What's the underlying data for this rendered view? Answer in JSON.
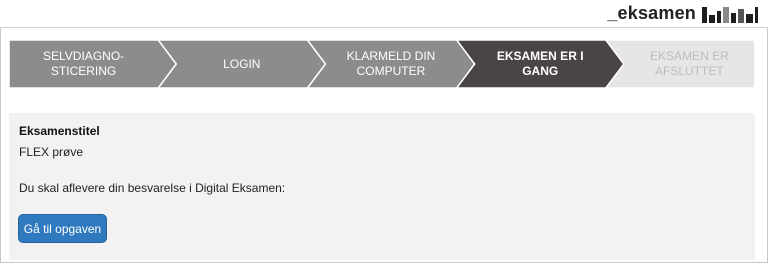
{
  "header": {
    "brand": "_eksamen"
  },
  "steps": [
    {
      "label": "SELVDIAGNO-\nSTICERING",
      "state": "done"
    },
    {
      "label": "LOGIN",
      "state": "done"
    },
    {
      "label": "KLARMELD DIN\nCOMPUTER",
      "state": "done"
    },
    {
      "label": "EKSAMEN ER I\nGANG",
      "state": "active"
    },
    {
      "label": "EKSAMEN ER\nAFSLUTTET",
      "state": "upcoming"
    }
  ],
  "colors": {
    "done": "#8c8c8c",
    "active": "#4a4444",
    "upcoming": "#e6e6e6",
    "button": "#2f7abf"
  },
  "exam": {
    "title_label": "Eksamenstitel",
    "title_value": "FLEX prøve",
    "instruction": "Du skal aflevere din besvarelse i Digital Eksamen:",
    "button_label": "Gå til opgaven"
  }
}
